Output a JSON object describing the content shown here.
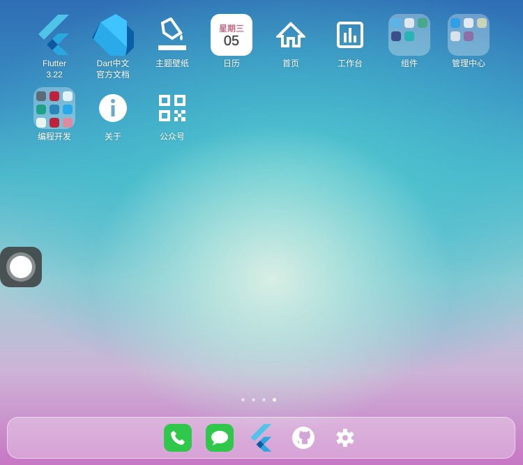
{
  "apps": [
    {
      "label": "Flutter\n3.22",
      "icon": "flutter-icon"
    },
    {
      "label": "Dart中文\n官方文档",
      "icon": "dart-icon"
    },
    {
      "label": "主题壁纸",
      "icon": "paint-bucket-icon"
    },
    {
      "label": "日历",
      "icon": "calendar-icon",
      "weekday": "星期三",
      "day": "05"
    },
    {
      "label": "首页",
      "icon": "home-icon"
    },
    {
      "label": "工作台",
      "icon": "bar-chart-icon"
    },
    {
      "label": "组件",
      "icon": "folder-icon"
    },
    {
      "label": "管理中心",
      "icon": "folder-icon"
    },
    {
      "label": "编程开发",
      "icon": "folder-icon"
    },
    {
      "label": "关于",
      "icon": "info-icon"
    },
    {
      "label": "公众号",
      "icon": "qr-code-icon"
    }
  ],
  "page_indicator": {
    "count": 4,
    "current": 4
  },
  "dock": [
    "phone-icon",
    "messages-icon",
    "flutter-icon",
    "github-icon",
    "settings-icon"
  ],
  "colors": {
    "phone": "#2fc84a",
    "messages": "#2fc84a",
    "calendar_weekday": "#c2466a"
  }
}
